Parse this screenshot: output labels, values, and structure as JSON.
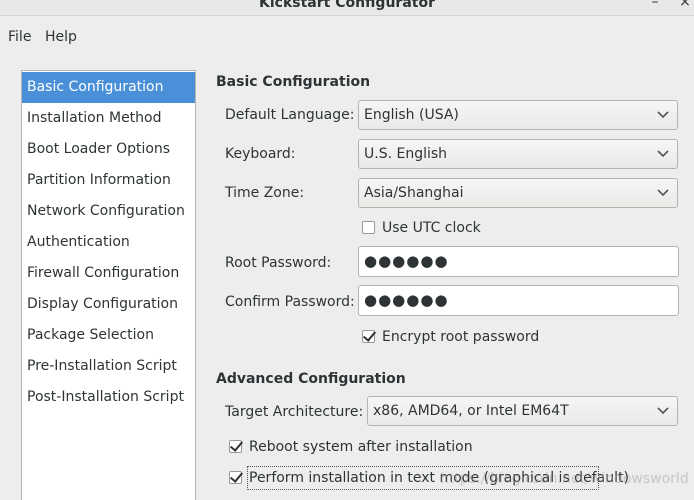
{
  "window": {
    "title": "Kickstart Configurator",
    "minimize_glyph": "–",
    "close_glyph": "×"
  },
  "menubar": {
    "file": "File",
    "help": "Help"
  },
  "sidebar": {
    "items": [
      {
        "label": "Basic Configuration",
        "selected": true
      },
      {
        "label": "Installation Method"
      },
      {
        "label": "Boot Loader Options"
      },
      {
        "label": "Partition Information"
      },
      {
        "label": "Network Configuration"
      },
      {
        "label": "Authentication"
      },
      {
        "label": "Firewall Configuration"
      },
      {
        "label": "Display Configuration"
      },
      {
        "label": "Package Selection"
      },
      {
        "label": "Pre-Installation Script"
      },
      {
        "label": "Post-Installation Script"
      }
    ]
  },
  "basic": {
    "section_title": "Basic Configuration",
    "default_language_label": "Default Language:",
    "default_language_value": "English (USA)",
    "keyboard_label": "Keyboard:",
    "keyboard_value": "U.S. English",
    "timezone_label": "Time Zone:",
    "timezone_value": "Asia/Shanghai",
    "utc_label": "Use UTC clock",
    "utc_checked": false,
    "root_password_label": "Root Password:",
    "root_password_value": "●●●●●●",
    "confirm_password_label": "Confirm Password:",
    "confirm_password_value": "●●●●●●",
    "encrypt_label": "Encrypt root password",
    "encrypt_checked": true
  },
  "advanced": {
    "section_title": "Advanced Configuration",
    "target_arch_label": "Target Architecture:",
    "target_arch_value": "x86, AMD64, or Intel EM64T",
    "reboot_label": "Reboot system after installation",
    "reboot_checked": true,
    "textmode_label": "Perform installation in text mode (graphical is default)",
    "textmode_checked": true
  },
  "watermark": "https://blog.csdn.net/windowsworld",
  "colors": {
    "selection": "#4a90d9",
    "window_bg": "#ededed"
  }
}
